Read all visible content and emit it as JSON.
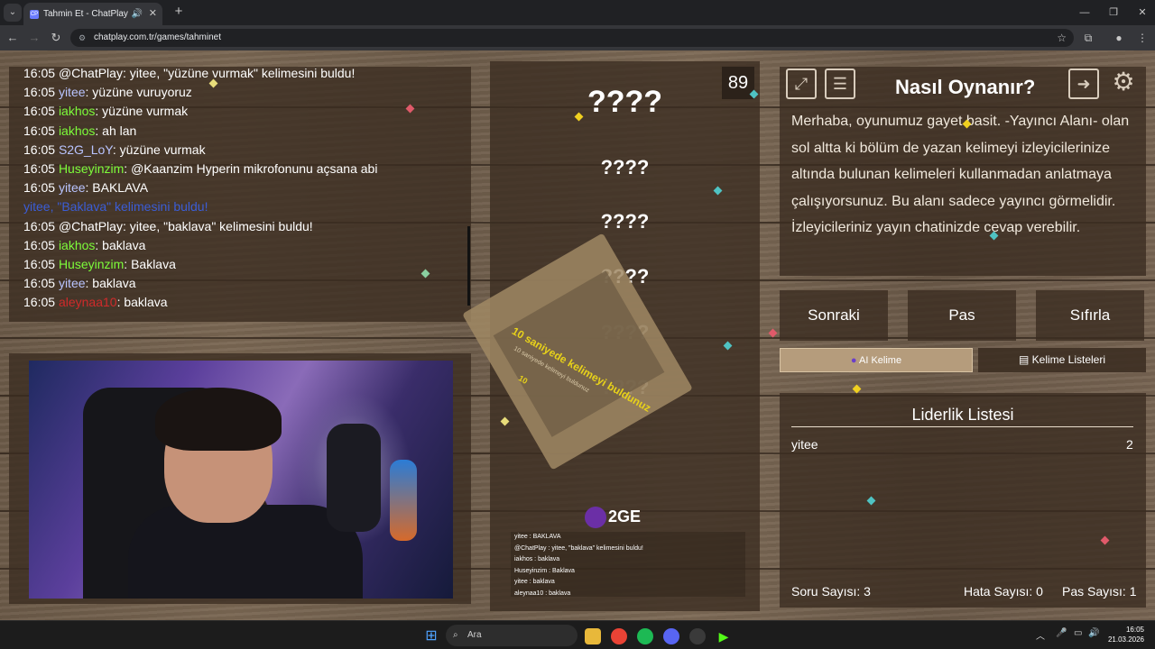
{
  "browser": {
    "tab_title": "Tahmin Et - ChatPlay",
    "tab_favicon": "CP",
    "url": "chatplay.com.tr/games/tahminet"
  },
  "chat": {
    "lines": [
      {
        "time": "16:05",
        "user": "@ChatPlay",
        "user_color": "#ffffff",
        "text": ": yitee, \"yüzüne vurmak\" kelimesini buldu!"
      },
      {
        "time": "16:05",
        "user": "yitee",
        "user_color": "#b9c4ff",
        "text": ": yüzüne vuruyoruz"
      },
      {
        "time": "16:05",
        "user": "iakhos",
        "user_color": "#7dfc3a",
        "text": ": yüzüne vurmak"
      },
      {
        "time": "16:05",
        "user": "iakhos",
        "user_color": "#7dfc3a",
        "text": ": ah lan"
      },
      {
        "time": "16:05",
        "user": "S2G_LoY",
        "user_color": "#b9c4ff",
        "text": ": yüzüne vurmak"
      },
      {
        "time": "16:05",
        "user": "Huseyinzim",
        "user_color": "#7dfc3a",
        "text": ": @Kaanzim Hyperin mikrofonunu açsana abi"
      },
      {
        "time": "16:05",
        "user": "yitee",
        "user_color": "#b9c4ff",
        "text": ": BAKLAVA"
      },
      {
        "time": "",
        "user": "yitee, \"Baklava\" kelimesini buldu!",
        "user_color": "#3b5dd6",
        "text": ""
      },
      {
        "time": "16:05",
        "user": "@ChatPlay",
        "user_color": "#ffffff",
        "text": ": yitee, \"baklava\" kelimesini buldu!"
      },
      {
        "time": "16:05",
        "user": "iakhos",
        "user_color": "#7dfc3a",
        "text": ": baklava"
      },
      {
        "time": "16:05",
        "user": "Huseyinzim",
        "user_color": "#7dfc3a",
        "text": ": Baklava"
      },
      {
        "time": "16:05",
        "user": "yitee",
        "user_color": "#b9c4ff",
        "text": ": baklava"
      },
      {
        "time": "16:05",
        "user": "aleynaa10",
        "user_color": "#d02a2a",
        "text": ": baklava"
      }
    ]
  },
  "game": {
    "timer": "89",
    "words": [
      "????",
      "????",
      "????",
      "????",
      "????",
      "????"
    ],
    "card_text": "10 saniyede kelimeyi buldunuz",
    "card_sub": "10 saniyede kelimeyi buldunuz",
    "card_num": "10",
    "logo_text": "2GE",
    "mini_chat": [
      "yitee : BAKLAVA",
      "@ChatPlay : yitee, \"baklava\" kelimesini buldu!",
      "iakhos : baklava",
      "Huseyinzim : Baklava",
      "yitee : baklava",
      "aleynaa10 : baklava"
    ]
  },
  "howto": {
    "title": "Nasıl Oynanır?",
    "text": "Merhaba, oyunumuz gayet basit. -Yayıncı Alanı- olan sol altta ki bölüm de yazan kelimeyi izleyicilerinize altında bulunan kelimeleri kullanmadan anlatmaya çalışıyorsunuz. Bu alanı sadece yayıncı görmelidir. İzleyicileriniz yayın chatinizde cevap verebilir.",
    "icons": [
      "fullscreen-icon",
      "document-icon",
      "exit-icon",
      "gear-icon"
    ]
  },
  "controls": {
    "next": "Sonraki",
    "pass": "Pas",
    "reset": "Sıfırla",
    "ai_word": "AI Kelime",
    "word_lists": "Kelime Listeleri"
  },
  "leaderboard": {
    "title": "Liderlik Listesi",
    "rows": [
      {
        "name": "yitee",
        "score": "2"
      }
    ]
  },
  "stats": {
    "questions": "Soru Sayısı: 3",
    "errors": "Hata Sayısı: 0",
    "passes": "Pas Sayısı: 1"
  },
  "taskbar": {
    "search_placeholder": "Ara",
    "time": "16:05",
    "date": "21.03.2026"
  }
}
